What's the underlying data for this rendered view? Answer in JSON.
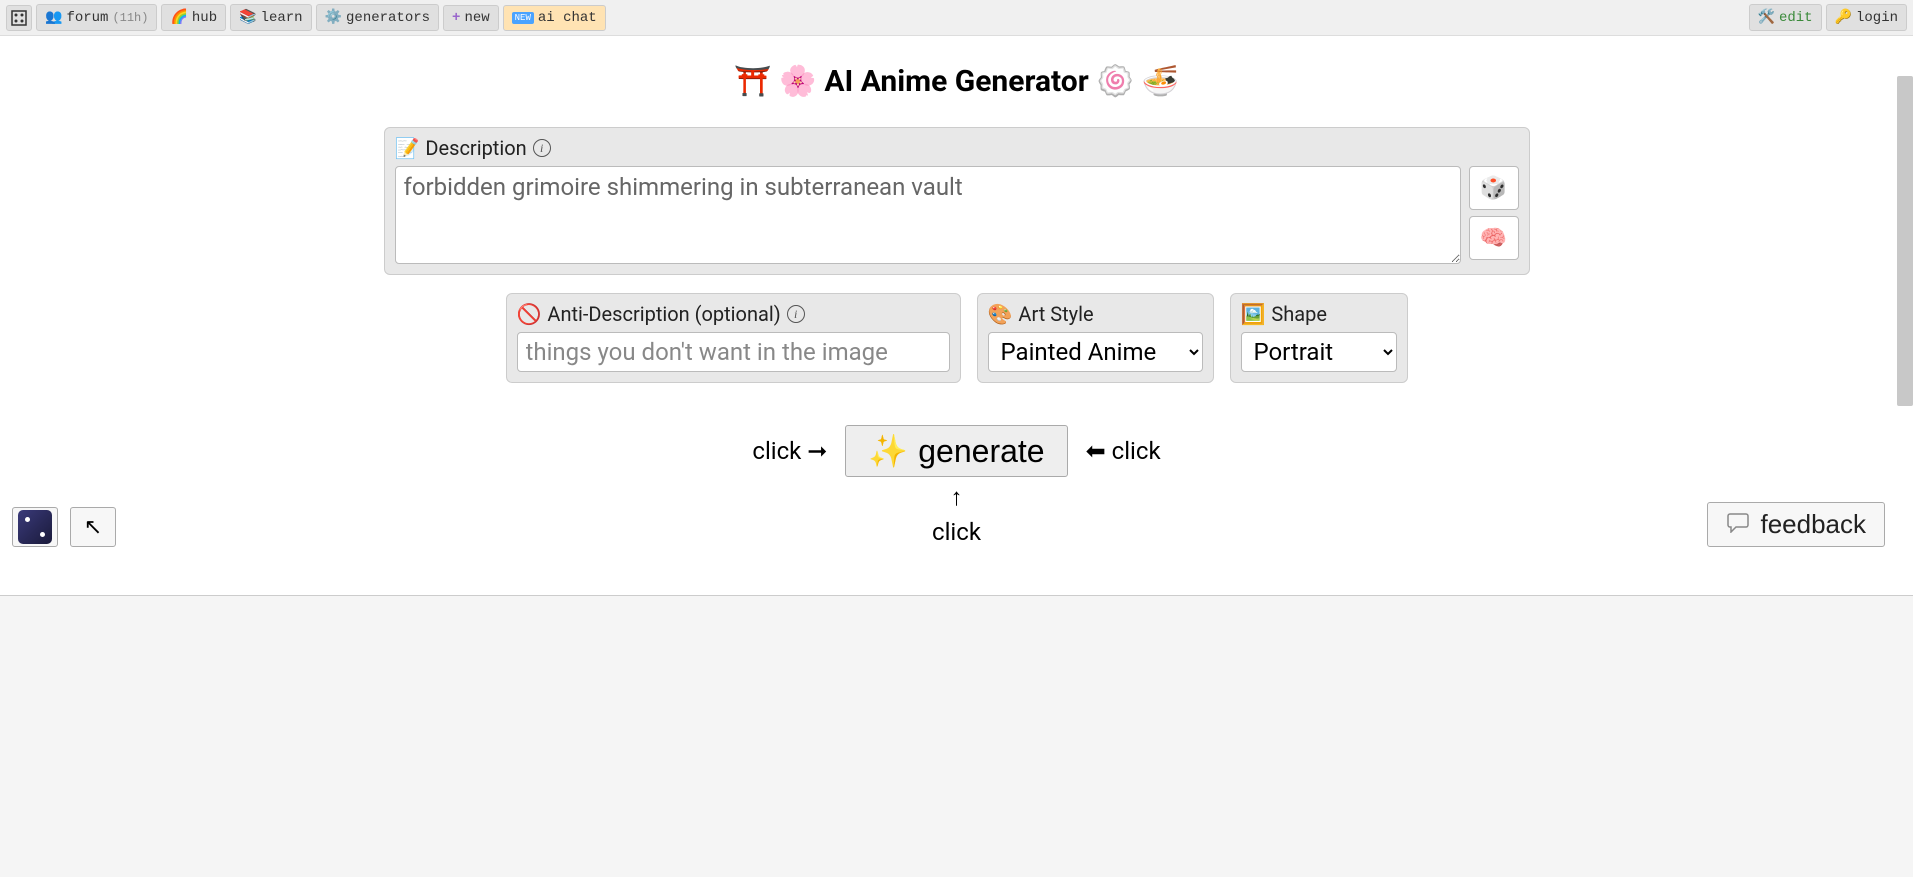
{
  "topbar": {
    "forum_label": "forum",
    "forum_time": "(11h)",
    "hub_label": "hub",
    "learn_label": "learn",
    "generators_label": "generators",
    "new_label": "new",
    "aichat_label": "ai chat",
    "edit_label": "edit",
    "login_label": "login"
  },
  "title": {
    "heading": "AI Anime Generator",
    "left_icons": "⛩️ 🌸",
    "right_icons": "🍥 🍜"
  },
  "description": {
    "label": "Description",
    "value": "forbidden grimoire shimmering in subterranean vault"
  },
  "anti": {
    "label": "Anti-Description (optional)",
    "placeholder": "things you don't want in the image"
  },
  "art_style": {
    "label": "Art Style",
    "selected": "Painted Anime"
  },
  "shape": {
    "label": "Shape",
    "selected": "Portrait"
  },
  "generate": {
    "label": "generate",
    "click_left": "click ➞",
    "click_right": "⬅ click",
    "click_arrow_up": "↑",
    "click_below": "click"
  },
  "feedback": {
    "label": "feedback"
  }
}
